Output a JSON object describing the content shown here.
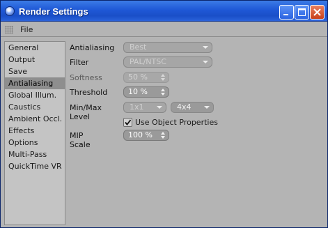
{
  "window": {
    "title": "Render Settings"
  },
  "menu": {
    "file": "File"
  },
  "sidebar": {
    "items": [
      {
        "label": "General"
      },
      {
        "label": "Output"
      },
      {
        "label": "Save"
      },
      {
        "label": "Antialiasing"
      },
      {
        "label": "Global Illum."
      },
      {
        "label": "Caustics"
      },
      {
        "label": "Ambient Occl."
      },
      {
        "label": "Effects"
      },
      {
        "label": "Options"
      },
      {
        "label": "Multi-Pass"
      },
      {
        "label": "QuickTime VR"
      }
    ],
    "selected": "Antialiasing"
  },
  "settings": {
    "antialiasing": {
      "label": "Antialiasing",
      "value": "Best"
    },
    "filter": {
      "label": "Filter",
      "value": "PAL/NTSC"
    },
    "softness": {
      "label": "Softness",
      "value": "50 %"
    },
    "threshold": {
      "label": "Threshold",
      "value": "10 %"
    },
    "minmax": {
      "label": "Min/Max Level",
      "min": "1x1",
      "max": "4x4"
    },
    "use_object_properties": {
      "label": "Use Object Properties",
      "checked": true
    },
    "mip_scale": {
      "label": "MIP Scale",
      "value": "100 %"
    }
  }
}
